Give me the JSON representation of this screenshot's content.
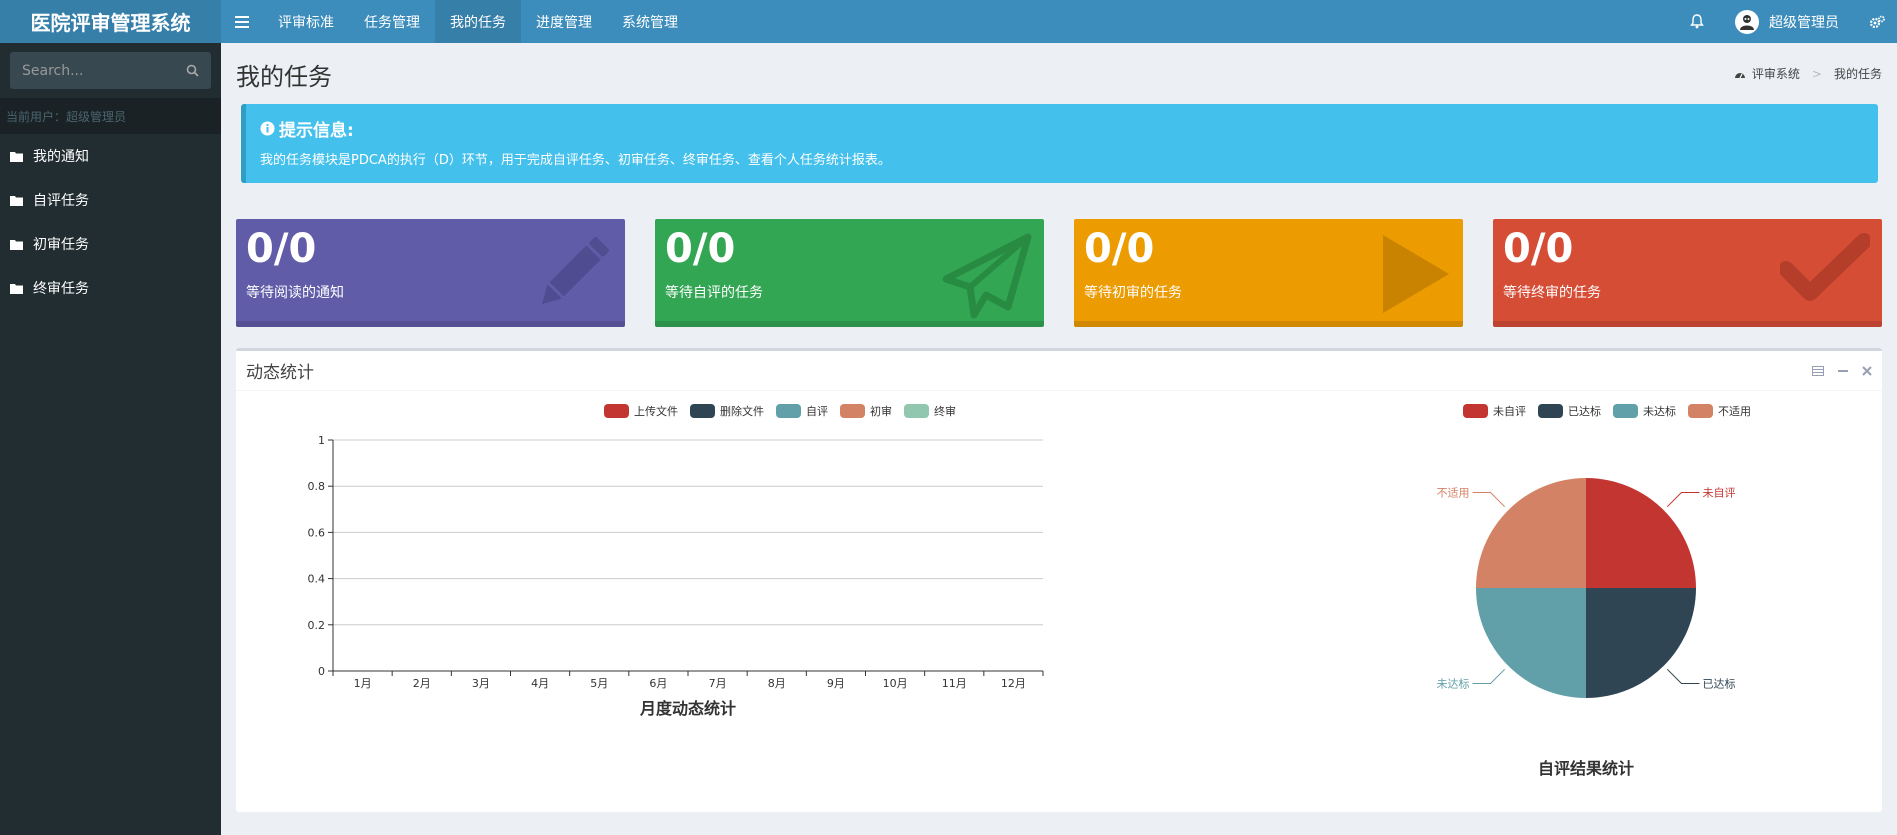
{
  "app": {
    "title": "医院评审管理系统"
  },
  "nav": {
    "items": [
      {
        "label": "评审标准",
        "active": false
      },
      {
        "label": "任务管理",
        "active": false
      },
      {
        "label": "我的任务",
        "active": true
      },
      {
        "label": "进度管理",
        "active": false
      },
      {
        "label": "系统管理",
        "active": false
      }
    ]
  },
  "user": {
    "name": "超级管理员"
  },
  "sidebar": {
    "search_placeholder": "Search...",
    "current_user": "当前用户：超级管理员",
    "items": [
      {
        "label": "我的通知",
        "icon": "folder-icon"
      },
      {
        "label": "自评任务",
        "icon": "folder-icon"
      },
      {
        "label": "初审任务",
        "icon": "folder-icon"
      },
      {
        "label": "终审任务",
        "icon": "folder-icon"
      }
    ]
  },
  "page": {
    "title": "我的任务",
    "breadcrumb": [
      "评审系统",
      "我的任务"
    ]
  },
  "callout": {
    "title": "提示信息:",
    "text": "我的任务模块是PDCA的执行（D）环节，用于完成自评任务、初审任务、终审任务、查看个人任务统计报表。"
  },
  "stats": [
    {
      "value": "0/0",
      "label": "等待阅读的通知",
      "color": "#605ca8",
      "icon": "pencil-icon"
    },
    {
      "value": "0/0",
      "label": "等待自评的任务",
      "color": "#33a654",
      "icon": "paper-plane-icon"
    },
    {
      "value": "0/0",
      "label": "等待初审的任务",
      "color": "#ec9b00",
      "icon": "play-icon"
    },
    {
      "value": "0/0",
      "label": "等待终审的任务",
      "color": "#d64d36",
      "icon": "check-icon"
    }
  ],
  "panel": {
    "title": "动态统计"
  },
  "chart_data": [
    {
      "type": "line",
      "title": "月度动态统计",
      "categories": [
        "1月",
        "2月",
        "3月",
        "4月",
        "5月",
        "6月",
        "7月",
        "8月",
        "9月",
        "10月",
        "11月",
        "12月"
      ],
      "series": [
        {
          "name": "上传文件",
          "color": "#c23531",
          "values": []
        },
        {
          "name": "删除文件",
          "color": "#2f4554",
          "values": []
        },
        {
          "name": "自评",
          "color": "#61a0a8",
          "values": []
        },
        {
          "name": "初审",
          "color": "#d48265",
          "values": []
        },
        {
          "name": "终审",
          "color": "#91c7ae",
          "values": []
        }
      ],
      "yticks": [
        "0",
        "0.2",
        "0.4",
        "0.6",
        "0.8",
        "1"
      ],
      "ylim": [
        0,
        1
      ],
      "grid": true,
      "legend": "top-center"
    },
    {
      "type": "pie",
      "title": "自评结果统计",
      "series": [
        {
          "name": "未自评",
          "color": "#c23531",
          "value": 1
        },
        {
          "name": "已达标",
          "color": "#2f4554",
          "value": 1
        },
        {
          "name": "未达标",
          "color": "#61a0a8",
          "value": 1
        },
        {
          "name": "不适用",
          "color": "#d48265",
          "value": 1
        }
      ],
      "legend": "top-center"
    }
  ]
}
